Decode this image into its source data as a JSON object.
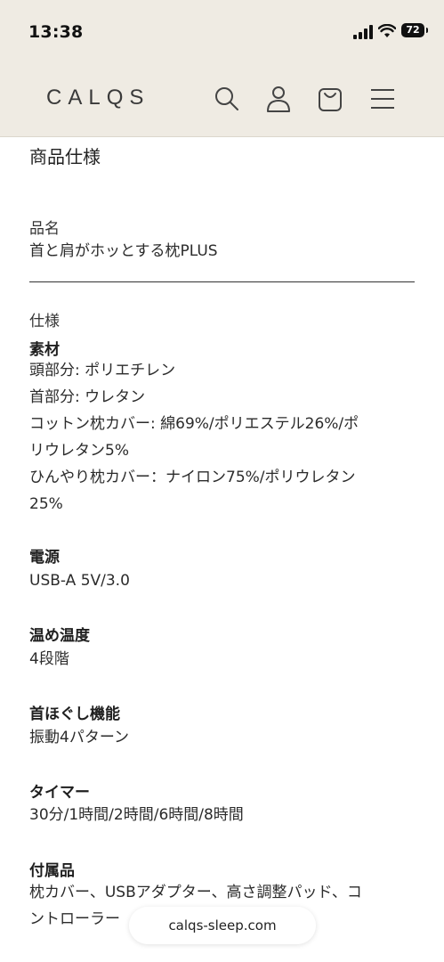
{
  "status": {
    "time": "13:38",
    "battery": "72"
  },
  "header": {
    "logo": "CALQS",
    "icons": [
      "search-icon",
      "account-icon",
      "cart-icon",
      "menu-icon"
    ]
  },
  "spec": {
    "section_title": "商品仕様",
    "name_label": "品名",
    "name_value": "首と肩がホッとする枕PLUS",
    "spec_label": "仕様",
    "material_heading": "素材",
    "material_lines": [
      "頭部分: ポリエチレン",
      "首部分: ウレタン",
      "コットン枕カバー: 綿69%/ポリエステル26%/ポ",
      "リウレタン5%",
      "ひんやり枕カバー：ナイロン75%/ポリウレタン",
      "25%"
    ],
    "power_heading": "電源",
    "power_value": "USB-A 5V/3.0",
    "temp_heading": "温め温度",
    "temp_value": "4段階",
    "massage_heading": "首ほぐし機能",
    "massage_value": "振動4パターン",
    "timer_heading": "タイマー",
    "timer_value": "30分/1時間/2時間/6時間/8時間",
    "accessory_heading": "付属品",
    "accessory_lines": [
      "枕カバー、USBアダプター、高さ調整パッド、コ",
      "ントローラー"
    ]
  },
  "browser": {
    "url": "calqs-sleep.com"
  },
  "colors": {
    "header_bg": "#efebe3",
    "text": "#2b2b2b",
    "divider": "#333333"
  }
}
